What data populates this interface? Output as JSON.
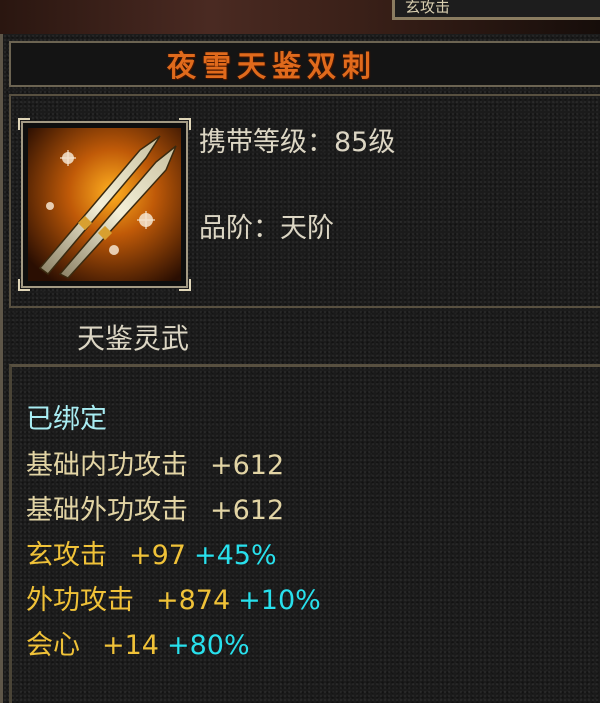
{
  "header": {
    "partial_text": "玄攻击"
  },
  "item": {
    "name": "夜雪天鉴双刺",
    "icon": "twin-daggers-icon",
    "level": {
      "label": "携带等级：",
      "value": "85级"
    },
    "grade": {
      "label": "品阶：",
      "value": "天阶"
    },
    "category": "天鉴灵武"
  },
  "stats": {
    "bound": "已绑定",
    "base": [
      {
        "name": "基础内功攻击",
        "value": "+612"
      },
      {
        "name": "基础外功攻击",
        "value": "+612"
      }
    ],
    "extra": [
      {
        "name": "玄攻击",
        "value": "+97",
        "percent": "+45%"
      },
      {
        "name": "外功攻击",
        "value": "+874",
        "percent": "+10%"
      },
      {
        "name": "会心",
        "value": "+14",
        "percent": "+80%"
      }
    ]
  },
  "colors": {
    "title": "#e06a1c",
    "base_stat": "#e2d4a4",
    "extra_stat": "#f0c238",
    "percent": "#28e0ec",
    "bound": "#a8ecf2"
  }
}
